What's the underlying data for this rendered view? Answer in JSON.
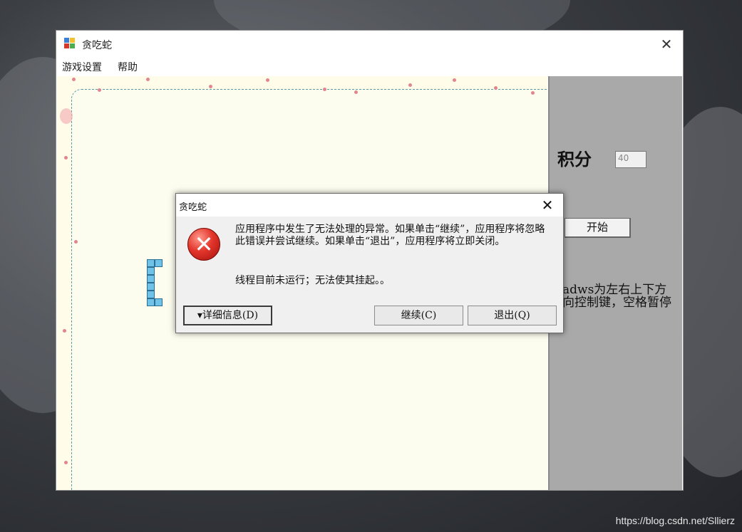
{
  "window": {
    "title": "贪吃蛇",
    "close_glyph": "✕",
    "menu": [
      {
        "label": "游戏设置"
      },
      {
        "label": "帮助"
      }
    ]
  },
  "sidepanel": {
    "score_label": "积分",
    "score_value": "40",
    "start_button": "开始",
    "hint": "adws为左右上下方向控制键，空格暂停"
  },
  "dialog": {
    "title": "贪吃蛇",
    "close_glyph": "✕",
    "message": "应用程序中发生了无法处理的异常。如果单击“继续”，应用程序将忽略此错误并尝试继续。如果单击“退出”，应用程序将立即关闭。",
    "detail": "线程目前未运行；无法使其挂起。。",
    "buttons": {
      "details": "▾详细信息(D)",
      "continue": "继续(C)",
      "exit": "退出(Q)"
    },
    "icon": "error-icon",
    "icon_glyph": "✕"
  },
  "watermark": "https://blog.csdn.net/Sllierz",
  "colors": {
    "snake": "#6fc3e8",
    "canvas": "#fdfdef",
    "panel": "#a9a9a9",
    "error": "#e3352b"
  }
}
